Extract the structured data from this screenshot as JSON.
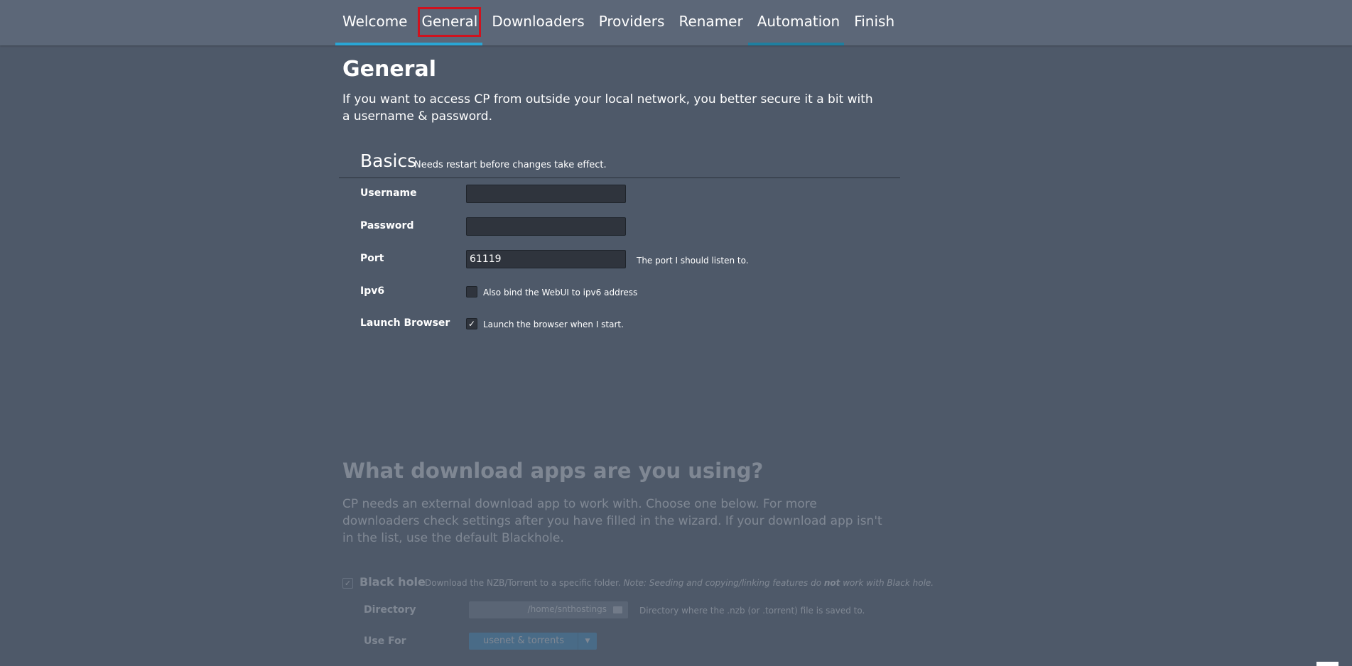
{
  "nav": {
    "tabs": [
      "Welcome",
      "General",
      "Downloaders",
      "Providers",
      "Renamer",
      "Automation",
      "Finish"
    ],
    "progress_accent": "#2aa6d5"
  },
  "general": {
    "title": "General",
    "intro": "If you want to access CP from outside your local network, you better secure it a bit with a username & password.",
    "group_name": "Basics",
    "group_hint": "Needs restart before changes take effect.",
    "username_label": "Username",
    "username_value": "",
    "password_label": "Password",
    "password_value": "",
    "port_label": "Port",
    "port_value": "61119",
    "port_desc": "The port I should listen to.",
    "ipv6_label": "Ipv6",
    "ipv6_checked": false,
    "ipv6_desc": "Also bind the WebUI to ipv6 address",
    "launch_label": "Launch Browser",
    "launch_checked": true,
    "launch_desc": "Launch the browser when I start."
  },
  "downloaders": {
    "title": "What download apps are you using?",
    "text": "CP needs an external download app to work with. Choose one below. For more downloaders check settings after you have filled in the wizard. If your download app isn't in the list, use the default Blackhole.",
    "blackhole_name": "Black hole",
    "blackhole_desc": "Download the NZB/Torrent to a specific folder.",
    "blackhole_note_a": "Note: Seeding and copying/linking features do",
    "blackhole_note_b": "not",
    "blackhole_note_c": "work with Black hole.",
    "directory_label": "Directory",
    "directory_value": "/home/snthostings",
    "directory_desc": "Directory where the .nzb (or .torrent) file is saved to.",
    "usefor_label": "Use For",
    "usefor_value": "usenet & torrents"
  },
  "icons": {
    "check": "checkmark-icon",
    "folder": "folder-icon",
    "dropdown": "caret-down-icon"
  }
}
